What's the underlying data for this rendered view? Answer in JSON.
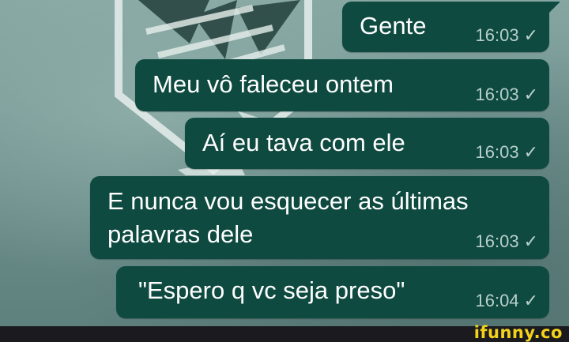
{
  "messages": [
    {
      "text_lines": [
        "Gente"
      ],
      "time": "16:03",
      "status": "✓"
    },
    {
      "text_lines": [
        "Meu vô faleceu ontem"
      ],
      "time": "16:03",
      "status": "✓"
    },
    {
      "text_lines": [
        "Aí eu tava com ele"
      ],
      "time": "16:03",
      "status": "✓"
    },
    {
      "text_lines": [
        "E nunca vou esquecer as últimas",
        "palavras dele"
      ],
      "time": "16:03",
      "status": "✓"
    },
    {
      "text_lines": [
        "\"Espero q vc seja preso\""
      ],
      "time": "16:04",
      "status": "✓"
    }
  ],
  "watermark": "ifunny.co",
  "colors": {
    "bubble": "#0e4a40",
    "background": "#6f918d",
    "meta_text": "#b8d0cb",
    "watermark": "#f3d21a"
  }
}
